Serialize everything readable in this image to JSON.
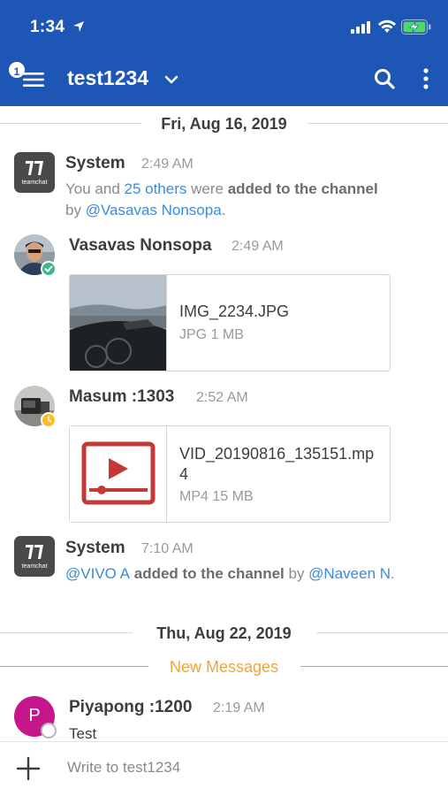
{
  "status_bar": {
    "time": "1:34"
  },
  "nav": {
    "menu_badge": "1",
    "channel_name": "test1234"
  },
  "date_separators": [
    "Fri, Aug 16, 2019",
    "Thu, Aug 22, 2019"
  ],
  "new_messages_label": "New Messages",
  "posts": [
    {
      "sender": "System",
      "time": "2:49 AM",
      "avatar_text": "teamchat",
      "body": {
        "prefix": "You and ",
        "mention_count": "25 others",
        "middle": " were ",
        "bold": "added to the channel",
        "by": " by ",
        "mention_user": "@Vasavas Nonsopa",
        "suffix": "."
      }
    },
    {
      "sender": "Vasavas Nonsopa",
      "time": "2:49 AM",
      "status": "online",
      "file": {
        "name": "IMG_2234.JPG",
        "meta": "JPG 1 MB",
        "kind": "image"
      }
    },
    {
      "sender": "Masum :1303",
      "time": "2:52 AM",
      "status": "away",
      "file": {
        "name": "VID_20190816_135151.mp4",
        "meta": "MP4 15 MB",
        "kind": "video"
      }
    },
    {
      "sender": "System",
      "time": "7:10 AM",
      "avatar_text": "teamchat",
      "body": {
        "mention_user": "@VIVO A",
        "bold": " added to the channel",
        "by": " by ",
        "mention_actor": "@Naveen N",
        "suffix": "."
      }
    },
    {
      "sender": "Piyapong :1200",
      "time": "2:19 AM",
      "avatar_initial": "P",
      "status": "offline",
      "text": "Test"
    }
  ],
  "composer": {
    "placeholder": "Write to test1234"
  },
  "colors": {
    "header": "#1e56b5",
    "mention": "#3c8ad8",
    "new_messages": "#f0a53a",
    "online": "#3db887",
    "away": "#ffbc1f",
    "piyapong_avatar": "#c5178b"
  }
}
